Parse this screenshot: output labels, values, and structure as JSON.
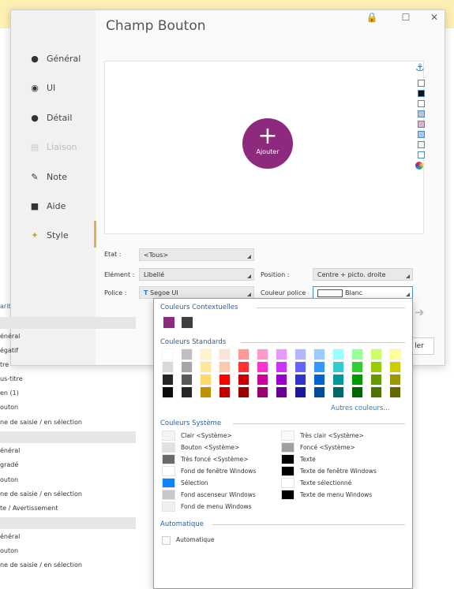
{
  "window": {
    "title": "Champ Bouton",
    "controls": [
      "lock-icon",
      "maximize-icon",
      "close-icon"
    ],
    "control_glyphs": {
      "lock": "🔒",
      "maximize": "☐",
      "close": "✕"
    }
  },
  "nav": {
    "items": [
      {
        "label": "Général",
        "icon": "circle-o-icon",
        "glyph": "●"
      },
      {
        "label": "UI",
        "icon": "eye-icon",
        "glyph": "◉"
      },
      {
        "label": "Détail",
        "icon": "gear-icon",
        "glyph": "●"
      },
      {
        "label": "Liaison",
        "icon": "calendar-icon",
        "glyph": "▤",
        "disabled": true
      },
      {
        "label": "Note",
        "icon": "pencil-icon",
        "glyph": "✎"
      },
      {
        "label": "Aide",
        "icon": "help-icon",
        "glyph": "■"
      },
      {
        "label": "Style",
        "icon": "brush-icon",
        "glyph": "✦",
        "active": true
      }
    ]
  },
  "preview": {
    "button_plus": "+",
    "button_label": "Ajouter",
    "button_color": "#8e2a7e"
  },
  "right_strip": {
    "anchor_glyph": "⚓"
  },
  "fields": {
    "etat": {
      "label": "Etat :",
      "value": "<Tous>"
    },
    "element": {
      "label": "Elément :",
      "value": "Libellé"
    },
    "position": {
      "label": "Position :",
      "value": "Centre + picto. droite"
    },
    "police": {
      "label": "Police :",
      "value": "Segoe UI",
      "font_icon_glyph": "T"
    },
    "couleur_police": {
      "label": "Couleur police",
      "value": "Blanc"
    }
  },
  "side_buttons": {
    "arrow_glyph": "➜",
    "partial_button": "ler"
  },
  "left_list": {
    "items": [
      {
        "label": "arit",
        "bar": false
      },
      {
        "label": "",
        "bar": true
      },
      {
        "label": "énéral",
        "bar": false
      },
      {
        "label": "égatif",
        "bar": false
      },
      {
        "label": "tre",
        "bar": false
      },
      {
        "label": "us-titre",
        "bar": false
      },
      {
        "label": "en (1)",
        "bar": false
      },
      {
        "label": "outon",
        "bar": false
      },
      {
        "label": "ne de saisie / en sélection",
        "bar": false
      },
      {
        "label": "",
        "bar": true
      },
      {
        "label": "énéral",
        "bar": false
      },
      {
        "label": "gradé",
        "bar": false
      },
      {
        "label": "outon",
        "bar": false
      },
      {
        "label": "ne de saisie / en sélection",
        "bar": false
      },
      {
        "label": "te / Avertissement",
        "bar": false
      },
      {
        "label": "",
        "bar": true
      },
      {
        "label": "énéral",
        "bar": false
      },
      {
        "label": "outon",
        "bar": false
      },
      {
        "label": "ne de saisie / en sélection",
        "bar": false
      }
    ]
  },
  "popup": {
    "contextual": {
      "title": "Couleurs Contextuelles",
      "colors": [
        "#8e2a7e",
        "#3f3f3f"
      ]
    },
    "standards": {
      "title": "Couleurs Standards",
      "more_link": "Autres couleurs...",
      "columns": [
        [
          "#ffffff",
          "#d9d9d9",
          "#262626",
          "#0d0d0d"
        ],
        [
          "#bfbfbf",
          "#a6a6a6",
          "#595959",
          "#262626"
        ],
        [
          "#fff2cc",
          "#ffe699",
          "#ffd966",
          "#bf9000"
        ],
        [
          "#fbe5d6",
          "#f8cbad",
          "#ff0000",
          "#c00000"
        ],
        [
          "#ff9999",
          "#ff3333",
          "#cc0000",
          "#990000"
        ],
        [
          "#ff99cc",
          "#ff33cc",
          "#cc0099",
          "#99006b"
        ],
        [
          "#e599ff",
          "#cc33ff",
          "#9900cc",
          "#660099"
        ],
        [
          "#b4b4ff",
          "#6666ff",
          "#3333cc",
          "#1a1a99"
        ],
        [
          "#99ccff",
          "#3399ff",
          "#0066cc",
          "#004c99"
        ],
        [
          "#99ffff",
          "#33cccc",
          "#009999",
          "#006666"
        ],
        [
          "#99ff99",
          "#33cc33",
          "#009900",
          "#006600"
        ],
        [
          "#ccff66",
          "#99cc00",
          "#669900",
          "#4d7300"
        ],
        [
          "#ffff99",
          "#cccc00",
          "#999900",
          "#666600"
        ]
      ]
    },
    "system": {
      "title": "Couleurs Système",
      "left": [
        {
          "label": "Clair <Système>",
          "color": "#f4f4f4"
        },
        {
          "label": "Bouton <Système>",
          "color": "#e1e1e1"
        },
        {
          "label": "Très foncé <Système>",
          "color": "#696969"
        },
        {
          "label": "Fond de fenêtre Windows",
          "color": "#ffffff"
        },
        {
          "label": "Sélection",
          "color": "#0a84ff"
        },
        {
          "label": "Fond ascenseur Windows",
          "color": "#c8c8c8"
        },
        {
          "label": "Fond de menu Windows",
          "color": "#f0f0f0"
        }
      ],
      "right": [
        {
          "label": "Très clair <Système>",
          "color": "#fafafa"
        },
        {
          "label": "Foncé <Système>",
          "color": "#a0a0a0"
        },
        {
          "label": "Texte",
          "color": "#000000"
        },
        {
          "label": "Texte de fenêtre Windows",
          "color": "#000000"
        },
        {
          "label": "Texte sélectionné",
          "color": "#ffffff"
        },
        {
          "label": "Texte de menu Windows",
          "color": "#000000"
        }
      ]
    },
    "automatic": {
      "title": "Automatique",
      "checkbox_label": "Automatique"
    }
  }
}
